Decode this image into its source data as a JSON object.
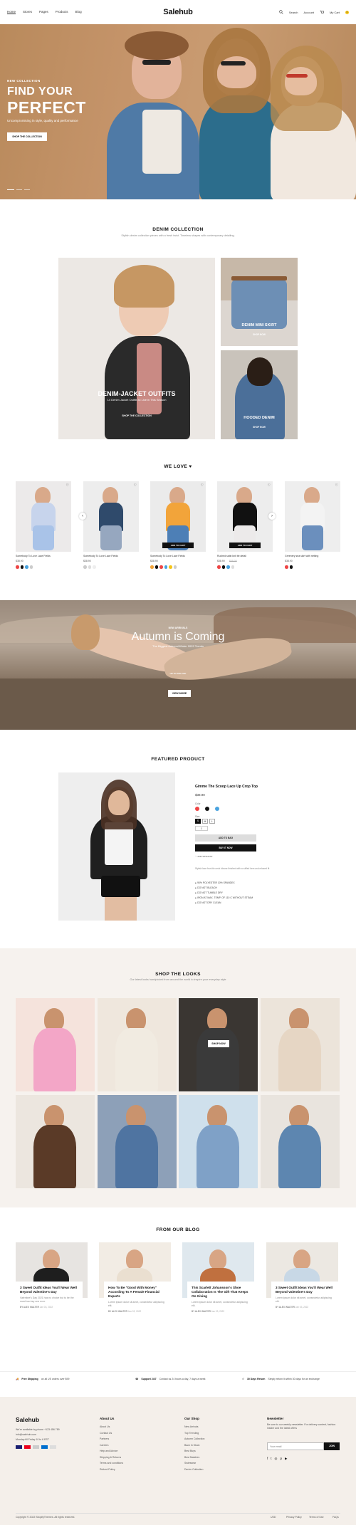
{
  "header": {
    "nav": [
      "Home",
      "Stores",
      "Pages",
      "Products",
      "Blog"
    ],
    "logo": "Salehub",
    "search": "Search",
    "account": "Account",
    "cart": "My Cart",
    "cart_count": "0"
  },
  "hero": {
    "eyebrow": "NEW COLLECTION",
    "title1": "FIND YOUR",
    "title2": "PERFECT",
    "desc": "Uncompromising in style, quality and performance",
    "button": "SHOP THE COLLECTION"
  },
  "denim": {
    "title": "DENIM COLLECTION",
    "subtitle": "Stylish denim collection pieces with a fresh twist. Timeless shapes with contemporary detailing.",
    "main_label": "DENIM-JACKET OUTFITS",
    "main_sub": "14 Denim Jacket Outfits to Live in This Season",
    "main_button": "SHOP THE COLLECTION",
    "skirt_label": "DENIM MINI SKIRT",
    "skirt_button": "SHOP NOW",
    "hooded_label": "HOODED DENIM",
    "hooded_button": "SHOP NOW"
  },
  "welove": {
    "title": "WE LOVE",
    "products": [
      {
        "name": "Somebody To Love Lace Fields",
        "price": "$38.90",
        "btn": ""
      },
      {
        "name": "Somebody To Love Lace Fields",
        "price": "$38.90",
        "btn": ""
      },
      {
        "name": "Somebody To Love Lace Fields",
        "price": "$38.90",
        "btn": "ADD TO CART"
      },
      {
        "name": "Ruched satin knit tie detail",
        "price": "$38.90",
        "old": "$45.00",
        "btn": "ADD TO CART"
      },
      {
        "name": "Greenery sea skirt with netting",
        "price": "$38.90",
        "btn": ""
      }
    ]
  },
  "autumn": {
    "eyebrow": "NEW ARRIVALS",
    "title": "Autumn is Coming",
    "sub": "The Biggest Autumn/Winter 2022 Trends",
    "small": "UP TO 70% OFF",
    "button": "VIEW MORE"
  },
  "featured": {
    "title": "FEATURED PRODUCT",
    "name": "Gimme The Scoop Lace Up Crop Top",
    "price": "$38.90",
    "color_label": "Color",
    "size_label": "Size:",
    "sizes": [
      "S",
      "M",
      "L"
    ],
    "qty": "1",
    "add": "ADD TO BAG",
    "buy": "BUY IT NOW",
    "wishlist": "ADD WISHLIST",
    "desc": "Stylish lace front tie neck blouse finished with a ruffled hem and relaxed fit",
    "bullets": [
      "90% POLYESTER 10% SPANDEX",
      "DO NOT BLEACH",
      "DO NOT TUMBLE DRY",
      "IRON AT MAX. TEMP. OF 110 C WITHOUT STEAM",
      "DO NOT DRY CLEAN"
    ]
  },
  "looks": {
    "title": "SHOP THE LOOKS",
    "subtitle": "Our latest looks handpicked from around the world to inspire your everyday style",
    "button": "SHOP NOW"
  },
  "blog": {
    "title": "FROM OUR BLOG",
    "posts": [
      {
        "title": "3 Sweet Outfit Ideas You'll Wear Well Beyond Valentine's Day",
        "excerpt": "Valentine's Day 2021 has no choice but to be the most low-key one ever.",
        "author": "BY ALEX WALTER",
        "date": "Jan 03, 2022"
      },
      {
        "title": "How To Be \"Good With Money\" According To A Female Financial Experts",
        "excerpt": "Lorem ipsum dolor sit amet, consectetur adipiscing elit.",
        "author": "BY ALEX WALTER",
        "date": "Jan 03, 2022"
      },
      {
        "title": "This Scarlett Johansson's Shoe Collaboration Is The Gift That Keeps On Giving",
        "excerpt": "Lorem ipsum dolor sit amet, consectetur adipiscing elit.",
        "author": "BY ALEX WALTER",
        "date": "Jan 03, 2022"
      },
      {
        "title": "3 Sweet Outfit Ideas You'll Wear Well Beyond Valentine's Day",
        "excerpt": "Lorem ipsum dolor sit amet, consectetur adipiscing elit.",
        "author": "BY ALEX WALTER",
        "date": "Jan 03, 2022"
      }
    ]
  },
  "features": [
    {
      "bold": "Free Shipping",
      "text": "on all US orders over $99"
    },
    {
      "bold": "Support 24/7",
      "text": "Contact us 24 hours a day, 7 days a week"
    },
    {
      "bold": "30 Days Return",
      "text": "Simply return it within 30 days for an exchange"
    }
  ],
  "footer": {
    "logo": "Salehub",
    "about": [
      "We're available by phone +123 456 789",
      "info@salehub.com",
      "Monday till Friday 10 to 6 EST"
    ],
    "col1": {
      "title": "About Us",
      "links": [
        "About Us",
        "Contact Us",
        "Partners",
        "Careers",
        "Help and Advice",
        "Shipping & Returns",
        "Terms and conditions",
        "Refund Policy"
      ]
    },
    "col2": {
      "title": "Our Shop",
      "links": [
        "New Arrivals",
        "Top Trending",
        "Autumn Collection",
        "Back In Stock",
        "Best Buys",
        "Best Matches",
        "Swimwear",
        "Denim Collection"
      ]
    },
    "newsletter": {
      "title": "Newsletter",
      "desc": "Be sure to our weekly newsletter. For delivery content, fashion insider and the latest offers",
      "placeholder": "Your email",
      "button": "JOIN"
    },
    "copyright": "Copyright © 2022 ShopifyThemes. All rights reserved.",
    "currency": "USD",
    "bottom_links": [
      "Privacy Policy",
      "Terms of Use",
      "FAQs"
    ]
  },
  "colors": {
    "accent": "#111111",
    "footer_bg": "#f4efea",
    "looks_bg": "#f6f2ee"
  }
}
